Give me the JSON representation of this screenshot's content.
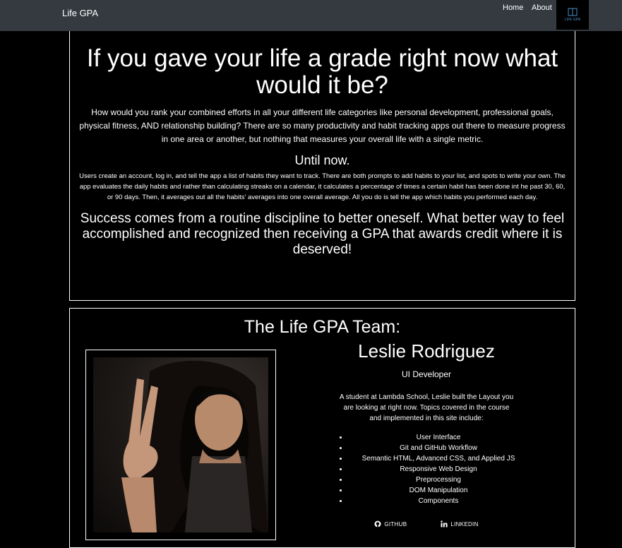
{
  "nav": {
    "brand": "Life GPA",
    "links": [
      "Home",
      "About"
    ],
    "logo_text": "LIFE GPA"
  },
  "intro": {
    "title": "If you gave your life a grade right now what would it be?",
    "paragraph": "How would you rank your combined efforts in all your different life categories like personal development, professional goals, physical fitness, AND relationship building? There are so many productivity and habit tracking apps out there to measure progress in one area or another, but nothing that measures your overall life with a single metric.",
    "subtitle": "Until now.",
    "details": "Users create an account, log in, and tell the app a list of habits they want to track. There are both prompts to add habits to your list, and spots to write your own. The app evaluates the daily habits and rather than calculating streaks on a calendar, it calculates a percentage of times a certain habit has been done int he past 30, 60, or 90 days. Then, it averages out all the habits' averages into one overall average. All you do is tell the app which habits you performed each day.",
    "closing": "Success comes from a routine discipline to better oneself. What better way to feel accomplished and recognized then receiving a GPA that awards credit where it is deserved!"
  },
  "team": {
    "title": "The Life GPA Team:",
    "member": {
      "name": "Leslie Rodriguez",
      "role": "UI Developer",
      "bio": "A student at Lambda School, Leslie built the Layout you are looking at right now. Topics covered in the course and implemented in this site include:",
      "skills": [
        "User Interface",
        "Git and GitHub Workflow",
        "Semantic HTML, Advanced CSS, and Applied JS",
        "Responsive Web Design",
        "Preprocessing",
        "DOM Manipulation",
        "Components"
      ],
      "github_label": "GITHUB",
      "linkedin_label": "LINKEDIN"
    }
  }
}
